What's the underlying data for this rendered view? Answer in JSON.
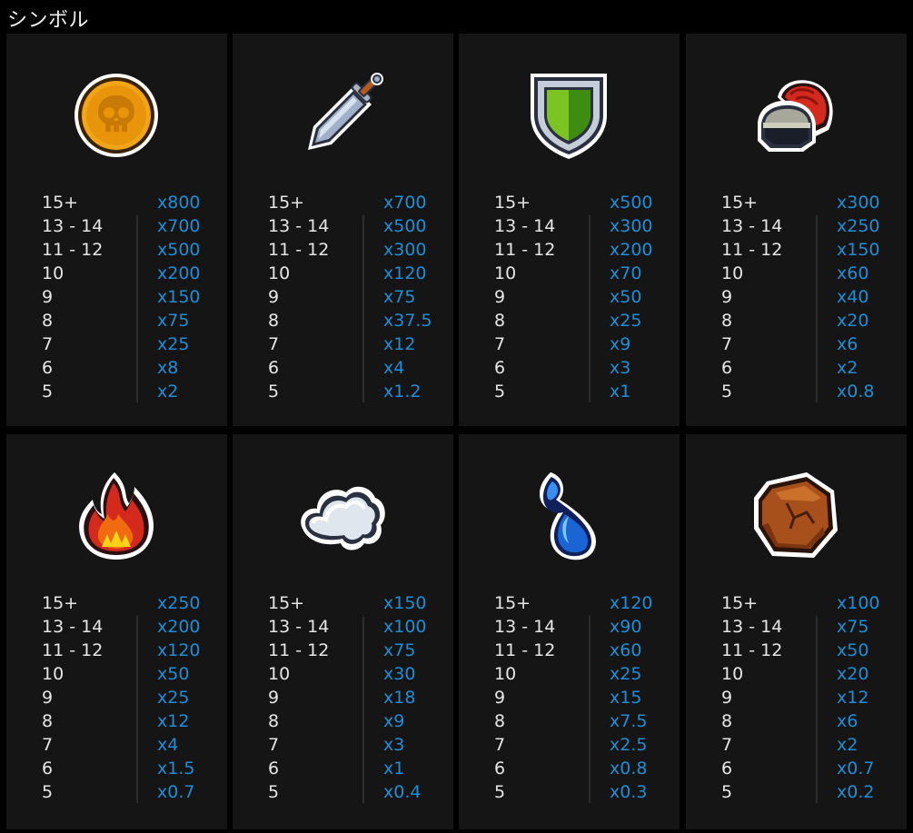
{
  "header": {
    "title": "シンボル"
  },
  "colors": {
    "background": "#000000",
    "card": "#151515",
    "count_text": "#e6e6e6",
    "multiplier_text": "#1e8fd6"
  },
  "symbols": [
    {
      "icon": "skull-coin-icon",
      "payouts": [
        {
          "count": "15+",
          "mult": "x800"
        },
        {
          "count": "13 - 14",
          "mult": "x700"
        },
        {
          "count": "11 - 12",
          "mult": "x500"
        },
        {
          "count": "10",
          "mult": "x200"
        },
        {
          "count": "9",
          "mult": "x150"
        },
        {
          "count": "8",
          "mult": "x75"
        },
        {
          "count": "7",
          "mult": "x25"
        },
        {
          "count": "6",
          "mult": "x8"
        },
        {
          "count": "5",
          "mult": "x2"
        }
      ]
    },
    {
      "icon": "sword-icon",
      "payouts": [
        {
          "count": "15+",
          "mult": "x700"
        },
        {
          "count": "13 - 14",
          "mult": "x500"
        },
        {
          "count": "11 - 12",
          "mult": "x300"
        },
        {
          "count": "10",
          "mult": "x120"
        },
        {
          "count": "9",
          "mult": "x75"
        },
        {
          "count": "8",
          "mult": "x37.5"
        },
        {
          "count": "7",
          "mult": "x12"
        },
        {
          "count": "6",
          "mult": "x4"
        },
        {
          "count": "5",
          "mult": "x1.2"
        }
      ]
    },
    {
      "icon": "shield-icon",
      "payouts": [
        {
          "count": "15+",
          "mult": "x500"
        },
        {
          "count": "13 - 14",
          "mult": "x300"
        },
        {
          "count": "11 - 12",
          "mult": "x200"
        },
        {
          "count": "10",
          "mult": "x70"
        },
        {
          "count": "9",
          "mult": "x50"
        },
        {
          "count": "8",
          "mult": "x25"
        },
        {
          "count": "7",
          "mult": "x9"
        },
        {
          "count": "6",
          "mult": "x3"
        },
        {
          "count": "5",
          "mult": "x1"
        }
      ]
    },
    {
      "icon": "helmet-icon",
      "payouts": [
        {
          "count": "15+",
          "mult": "x300"
        },
        {
          "count": "13 - 14",
          "mult": "x250"
        },
        {
          "count": "11 - 12",
          "mult": "x150"
        },
        {
          "count": "10",
          "mult": "x60"
        },
        {
          "count": "9",
          "mult": "x40"
        },
        {
          "count": "8",
          "mult": "x20"
        },
        {
          "count": "7",
          "mult": "x6"
        },
        {
          "count": "6",
          "mult": "x2"
        },
        {
          "count": "5",
          "mult": "x0.8"
        }
      ]
    },
    {
      "icon": "fire-icon",
      "payouts": [
        {
          "count": "15+",
          "mult": "x250"
        },
        {
          "count": "13 - 14",
          "mult": "x200"
        },
        {
          "count": "11 - 12",
          "mult": "x120"
        },
        {
          "count": "10",
          "mult": "x50"
        },
        {
          "count": "9",
          "mult": "x25"
        },
        {
          "count": "8",
          "mult": "x12"
        },
        {
          "count": "7",
          "mult": "x4"
        },
        {
          "count": "6",
          "mult": "x1.5"
        },
        {
          "count": "5",
          "mult": "x0.7"
        }
      ]
    },
    {
      "icon": "cloud-icon",
      "payouts": [
        {
          "count": "15+",
          "mult": "x150"
        },
        {
          "count": "13 - 14",
          "mult": "x100"
        },
        {
          "count": "11 - 12",
          "mult": "x75"
        },
        {
          "count": "10",
          "mult": "x30"
        },
        {
          "count": "9",
          "mult": "x18"
        },
        {
          "count": "8",
          "mult": "x9"
        },
        {
          "count": "7",
          "mult": "x3"
        },
        {
          "count": "6",
          "mult": "x1"
        },
        {
          "count": "5",
          "mult": "x0.4"
        }
      ]
    },
    {
      "icon": "water-drop-icon",
      "payouts": [
        {
          "count": "15+",
          "mult": "x120"
        },
        {
          "count": "13 - 14",
          "mult": "x90"
        },
        {
          "count": "11 - 12",
          "mult": "x60"
        },
        {
          "count": "10",
          "mult": "x25"
        },
        {
          "count": "9",
          "mult": "x15"
        },
        {
          "count": "8",
          "mult": "x7.5"
        },
        {
          "count": "7",
          "mult": "x2.5"
        },
        {
          "count": "6",
          "mult": "x0.8"
        },
        {
          "count": "5",
          "mult": "x0.3"
        }
      ]
    },
    {
      "icon": "rock-icon",
      "payouts": [
        {
          "count": "15+",
          "mult": "x100"
        },
        {
          "count": "13 - 14",
          "mult": "x75"
        },
        {
          "count": "11 - 12",
          "mult": "x50"
        },
        {
          "count": "10",
          "mult": "x20"
        },
        {
          "count": "9",
          "mult": "x12"
        },
        {
          "count": "8",
          "mult": "x6"
        },
        {
          "count": "7",
          "mult": "x2"
        },
        {
          "count": "6",
          "mult": "x0.7"
        },
        {
          "count": "5",
          "mult": "x0.2"
        }
      ]
    }
  ]
}
